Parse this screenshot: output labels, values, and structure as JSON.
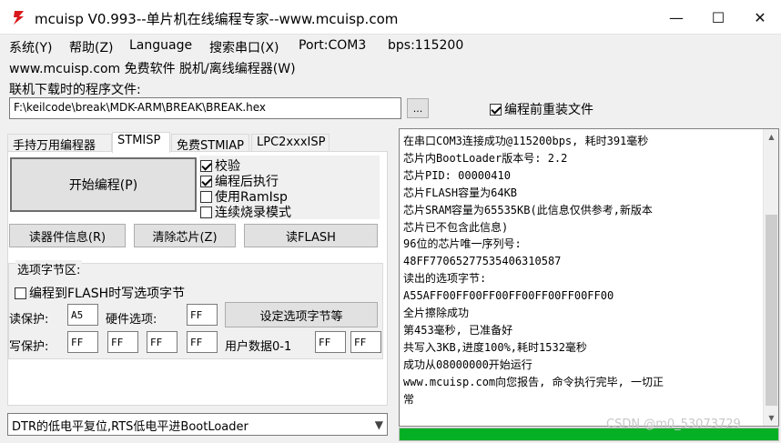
{
  "window": {
    "title": "mcuisp V0.993--单片机在线编程专家--www.mcuisp.com",
    "minimize": "—",
    "maximize": "☐",
    "close": "✕"
  },
  "menu": {
    "items": [
      "系统(Y)",
      "帮助(Z)",
      "Language",
      "搜索串口(X)",
      "Port:COM3",
      "bps:115200"
    ],
    "subline": "www.mcuisp.com 免费软件 脱机/离线编程器(W)"
  },
  "file": {
    "label": "联机下载时的程序文件:",
    "path": "F:\\keilcode\\break\\MDK-ARM\\BREAK\\BREAK.hex",
    "browse": "...",
    "reload_label": "编程前重装文件",
    "reload_checked": true
  },
  "tabs": [
    "手持万用编程器",
    "STMISP",
    "免费STMIAP",
    "LPC2xxxISP"
  ],
  "active_tab": 1,
  "actions": {
    "start": "开始编程(P)",
    "read_info": "读器件信息(R)",
    "erase": "清除芯片(Z)",
    "read_flash": "读FLASH"
  },
  "options": [
    {
      "label": "校验",
      "checked": true
    },
    {
      "label": "编程后执行",
      "checked": true
    },
    {
      "label": "使用RamIsp",
      "checked": false
    },
    {
      "label": "连续烧录模式",
      "checked": false
    }
  ],
  "option_bytes": {
    "title": "选项字节区:",
    "program_label": "编程到FLASH时写选项字节",
    "program_checked": false,
    "read_protect_label": "读保护:",
    "read_protect_value": "A5",
    "hw_option_label": "硬件选项:",
    "hw_option_value": "FF",
    "set_button": "设定选项字节等",
    "write_protect_label": "写保护:",
    "write_protect_values": [
      "FF",
      "FF",
      "FF",
      "FF"
    ],
    "user_data_label": "用户数据0-1",
    "user_data_values": [
      "FF",
      "FF"
    ]
  },
  "bootloader_mode": "DTR的低电平复位,RTS低电平进BootLoader",
  "log": [
    "在串口COM3连接成功@115200bps, 耗时391毫秒",
    "芯片内BootLoader版本号: 2.2",
    "芯片PID: 00000410",
    "芯片FLASH容量为64KB",
    "芯片SRAM容量为65535KB(此信息仅供参考,新版本",
    "芯片已不包含此信息)",
    "96位的芯片唯一序列号:",
    "48FF77065277535406310587",
    "读出的选项字节:",
    "A55AFF00FF00FF00FF00FF00FF00FF00",
    "全片擦除成功",
    "第453毫秒, 已准备好",
    "共写入3KB,进度100%,耗时1532毫秒",
    "成功从08000000开始运行",
    "www.mcuisp.com向您报告, 命令执行完毕, 一切正",
    "常"
  ],
  "progress_fraction": 1.0,
  "progress_color": "#06b025",
  "watermark": "CSDN @m0_53073729",
  "icons": {
    "app": "mcuisp-lightning-icon",
    "check": "checkmark-icon",
    "dropdown": "chevron-down-icon"
  }
}
